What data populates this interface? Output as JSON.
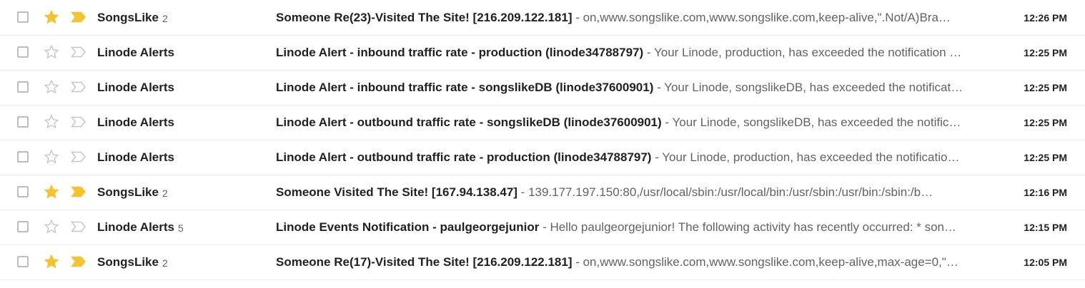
{
  "colors": {
    "star_on": "#f4c430",
    "star_off": "#c6c6c6",
    "important_on": "#f4c430",
    "important_off": "#c6c6c6",
    "row_border": "#eceff1"
  },
  "icons": {
    "checkbox": "checkbox-icon",
    "star": "star-icon",
    "important": "important-marker-icon"
  },
  "emails": [
    {
      "starred": true,
      "important": true,
      "sender": "SongsLike",
      "count": "2",
      "subject": "Someone Re(23)-Visited The Site! [216.209.122.181]",
      "separator": " - ",
      "snippet": "on,www.songslike.com,www.songslike.com,keep-alive,\".Not/A)Bra…",
      "time": "12:26 PM"
    },
    {
      "starred": false,
      "important": false,
      "sender": "Linode Alerts",
      "count": "",
      "subject": "Linode Alert - inbound traffic rate - production (linode34788797)",
      "separator": " - ",
      "snippet": "Your Linode, production, has exceeded the notification …",
      "time": "12:25 PM"
    },
    {
      "starred": false,
      "important": false,
      "sender": "Linode Alerts",
      "count": "",
      "subject": "Linode Alert - inbound traffic rate - songslikeDB (linode37600901)",
      "separator": " - ",
      "snippet": "Your Linode, songslikeDB, has exceeded the notificat…",
      "time": "12:25 PM"
    },
    {
      "starred": false,
      "important": false,
      "sender": "Linode Alerts",
      "count": "",
      "subject": "Linode Alert - outbound traffic rate - songslikeDB (linode37600901)",
      "separator": " - ",
      "snippet": "Your Linode, songslikeDB, has exceeded the notific…",
      "time": "12:25 PM"
    },
    {
      "starred": false,
      "important": false,
      "sender": "Linode Alerts",
      "count": "",
      "subject": "Linode Alert - outbound traffic rate - production (linode34788797)",
      "separator": " - ",
      "snippet": "Your Linode, production, has exceeded the notificatio…",
      "time": "12:25 PM"
    },
    {
      "starred": true,
      "important": true,
      "sender": "SongsLike",
      "count": "2",
      "subject": "Someone Visited The Site! [167.94.138.47]",
      "separator": " - ",
      "snippet": "139.177.197.150:80,/usr/local/sbin:/usr/local/bin:/usr/sbin:/usr/bin:/sbin:/b…",
      "time": "12:16 PM"
    },
    {
      "starred": false,
      "important": false,
      "sender": "Linode Alerts",
      "count": "5",
      "subject": "Linode Events Notification - paulgeorgejunior",
      "separator": " - ",
      "snippet": "Hello paulgeorgejunior! The following activity has recently occurred: * son…",
      "time": "12:15 PM"
    },
    {
      "starred": true,
      "important": true,
      "sender": "SongsLike",
      "count": "2",
      "subject": "Someone Re(17)-Visited The Site! [216.209.122.181]",
      "separator": " - ",
      "snippet": "on,www.songslike.com,www.songslike.com,keep-alive,max-age=0,\"…",
      "time": "12:05 PM"
    }
  ]
}
